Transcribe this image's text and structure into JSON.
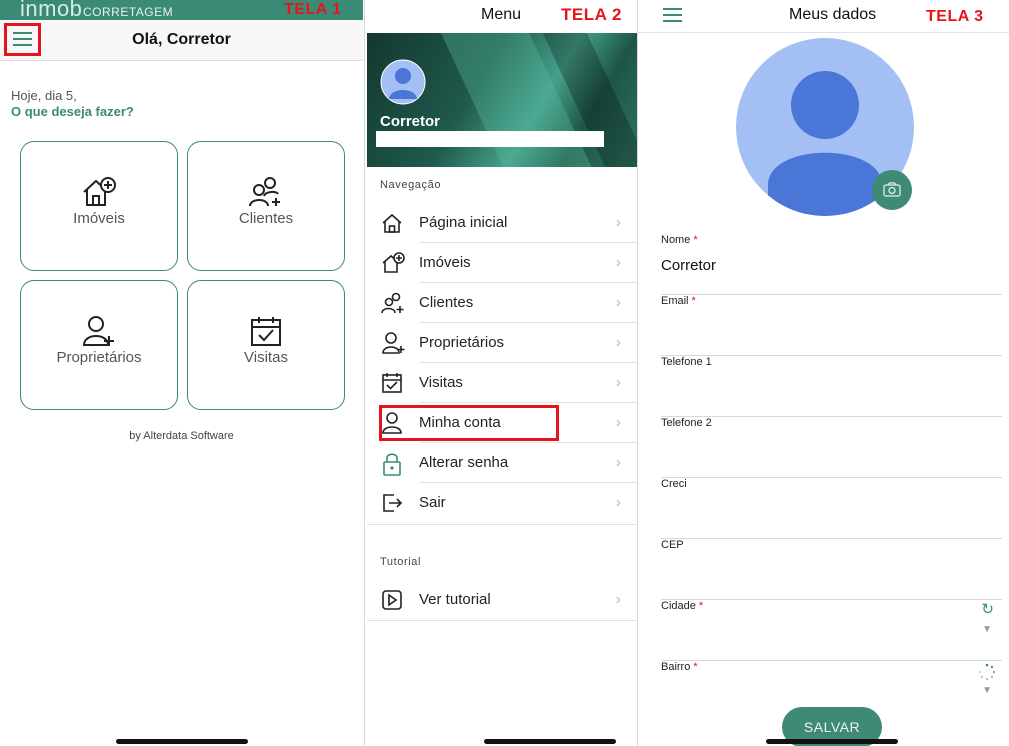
{
  "screen1": {
    "brand": "inmob",
    "brand_sub": "CORRETAGEM",
    "tag": "TELA 1",
    "title": "Olá, Corretor",
    "greeting": "Hoje, dia 5,",
    "question": "O que deseja fazer?",
    "tiles": [
      {
        "label": "Imóveis",
        "icon": "house-plus-icon"
      },
      {
        "label": "Clientes",
        "icon": "users-plus-icon"
      },
      {
        "label": "Proprietários",
        "icon": "user-plus-icon"
      },
      {
        "label": "Visitas",
        "icon": "calendar-check-icon"
      }
    ],
    "footer": "by Alterdata Software"
  },
  "screen2": {
    "title": "Menu",
    "tag": "TELA 2",
    "profile_name": "Corretor",
    "nav_section": "Navegação",
    "nav_items": [
      {
        "label": "Página inicial",
        "icon": "home-icon"
      },
      {
        "label": "Imóveis",
        "icon": "house-plus-icon"
      },
      {
        "label": "Clientes",
        "icon": "users-plus-icon"
      },
      {
        "label": "Proprietários",
        "icon": "user-plus-icon"
      },
      {
        "label": "Visitas",
        "icon": "calendar-check-icon"
      },
      {
        "label": "Minha conta",
        "icon": "user-icon"
      },
      {
        "label": "Alterar senha",
        "icon": "lock-icon"
      },
      {
        "label": "Sair",
        "icon": "logout-icon"
      }
    ],
    "tutorial_section": "Tutorial",
    "tutorial_items": [
      {
        "label": "Ver tutorial",
        "icon": "play-icon"
      }
    ]
  },
  "screen3": {
    "title": "Meus dados",
    "tag": "TELA 3",
    "fields": [
      {
        "label": "Nome",
        "required": "*",
        "value": "Corretor"
      },
      {
        "label": "Email",
        "required": "*",
        "value": ""
      },
      {
        "label": "Telefone 1",
        "required": "",
        "value": ""
      },
      {
        "label": "Telefone 2",
        "required": "",
        "value": ""
      },
      {
        "label": "Creci",
        "required": "",
        "value": ""
      },
      {
        "label": "CEP",
        "required": "",
        "value": ""
      },
      {
        "label": "Cidade",
        "required": "*",
        "value": ""
      },
      {
        "label": "Bairro",
        "required": "*",
        "value": ""
      }
    ],
    "save_label": "SALVAR"
  },
  "colors": {
    "accent": "#3b8a75",
    "highlight": "#e3141c",
    "avatar_light": "#a3bff4",
    "avatar_dark": "#4a76d8"
  }
}
